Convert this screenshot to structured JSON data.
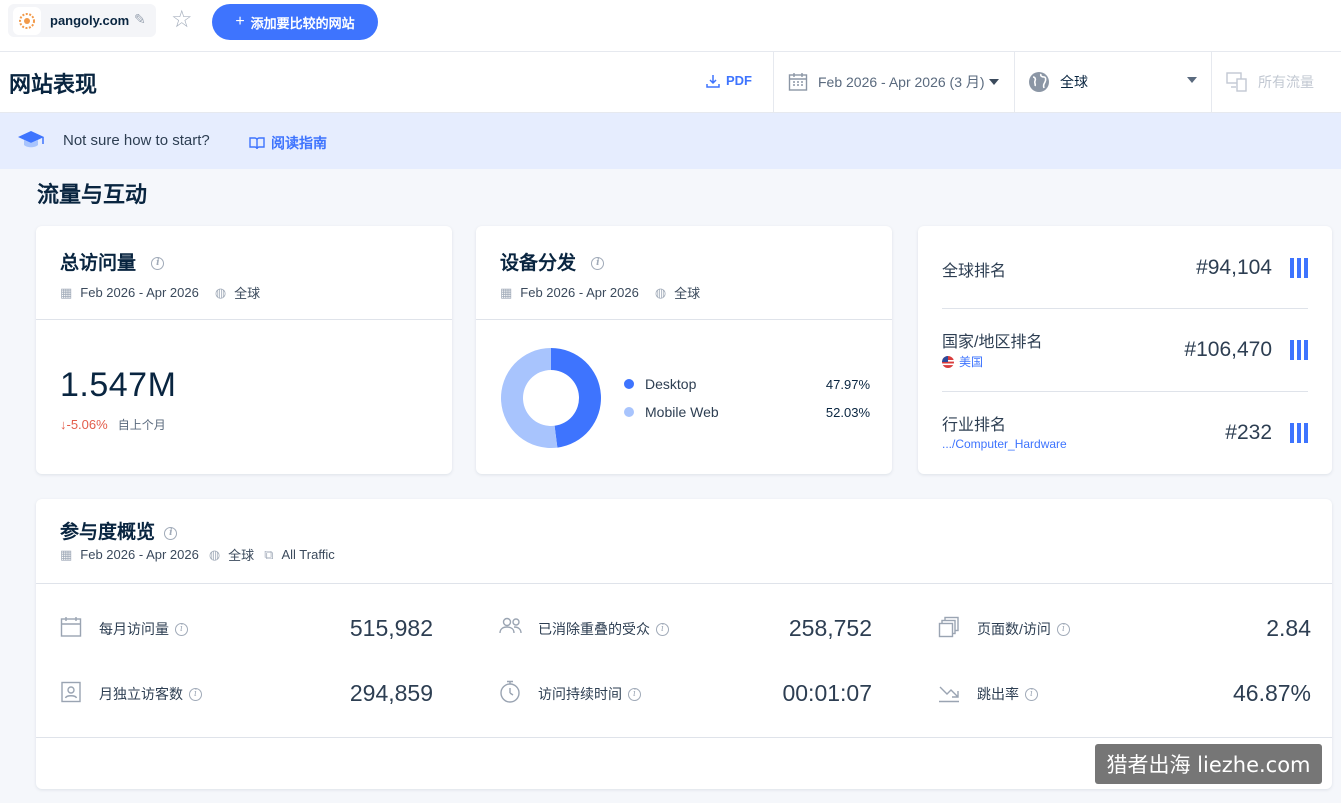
{
  "topbar": {
    "site": "pangoly.com",
    "add_compare_label": "添加要比较的网站"
  },
  "header": {
    "title": "网站表现",
    "pdf_label": "PDF",
    "date_range": "Feb 2026 - Apr 2026 (3 月)",
    "country": "全球",
    "traffic": "所有流量"
  },
  "banner": {
    "text": "Not sure how to start?",
    "link": "阅读指南"
  },
  "section_title": "流量与互动",
  "total_visits": {
    "title": "总访问量",
    "date": "Feb 2026 - Apr 2026",
    "region": "全球",
    "value": "1.547M",
    "change": "-5.06%",
    "change_label": "自上个月"
  },
  "device": {
    "title": "设备分发",
    "date": "Feb 2026 - Apr 2026",
    "region": "全球",
    "items": [
      {
        "label": "Desktop",
        "value": "47.97%",
        "share": 47.97,
        "color": "#3e74fe"
      },
      {
        "label": "Mobile Web",
        "value": "52.03%",
        "share": 52.03,
        "color": "#a8c4fd"
      }
    ]
  },
  "ranks": [
    {
      "label": "全球排名",
      "sub": "",
      "value": "#94,104"
    },
    {
      "label": "国家/地区排名",
      "sub": "美国",
      "value": "#106,470"
    },
    {
      "label": "行业排名",
      "sub": ".../Computer_Hardware",
      "value": "#232"
    }
  ],
  "engagement": {
    "title": "参与度概览",
    "date": "Feb 2026 - Apr 2026",
    "region": "全球",
    "traffic": "All Traffic",
    "metrics": [
      {
        "label": "每月访问量",
        "value": "515,982",
        "icon": "calendar-icon"
      },
      {
        "label": "已消除重叠的受众",
        "value": "258,752",
        "icon": "users-icon"
      },
      {
        "label": "页面数/访问",
        "value": "2.84",
        "icon": "pages-icon"
      },
      {
        "label": "月独立访客数",
        "value": "294,859",
        "icon": "id-card-icon"
      },
      {
        "label": "访问持续时间",
        "value": "00:01:07",
        "icon": "stopwatch-icon"
      },
      {
        "label": "跳出率",
        "value": "46.87%",
        "icon": "bounce-icon"
      }
    ]
  },
  "watermark": "猎者出海 liezhe.com"
}
